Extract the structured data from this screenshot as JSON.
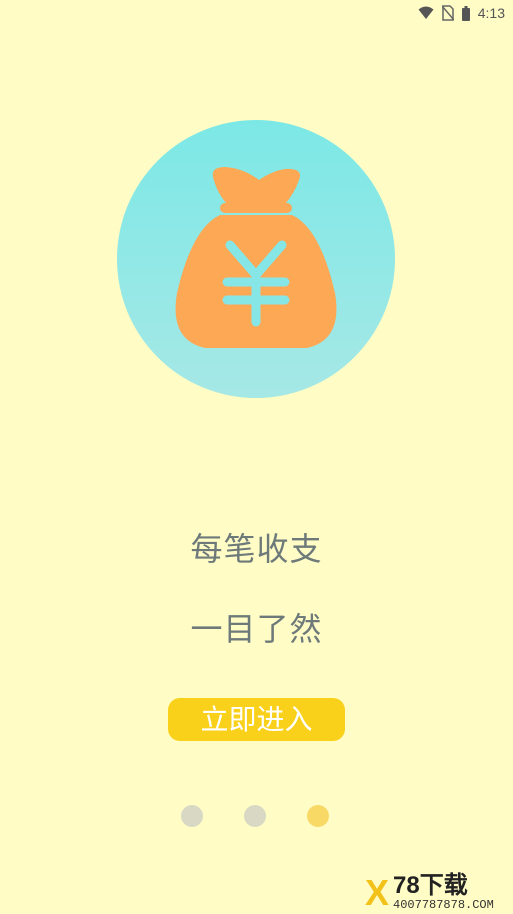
{
  "status_bar": {
    "time": "4:13",
    "icons": [
      "wifi-icon",
      "no-sim-icon",
      "battery-icon"
    ]
  },
  "hero": {
    "icon": "money-bag-icon",
    "symbol": "¥",
    "colors": {
      "circle": "#86E6E6",
      "bag": "#FCA855",
      "symbol": "#86E6E6"
    }
  },
  "content": {
    "line1": "每笔收支",
    "line2": "一目了然",
    "enter_label": "立即进入"
  },
  "pager": {
    "count": 3,
    "active_index": 2
  },
  "watermark": {
    "mark": "X",
    "title": "78下载",
    "subtitle": "4007787878.COM"
  },
  "colors": {
    "background": "#FFFCC6",
    "button": "#F9D11A",
    "text": "#6E7A7A"
  }
}
